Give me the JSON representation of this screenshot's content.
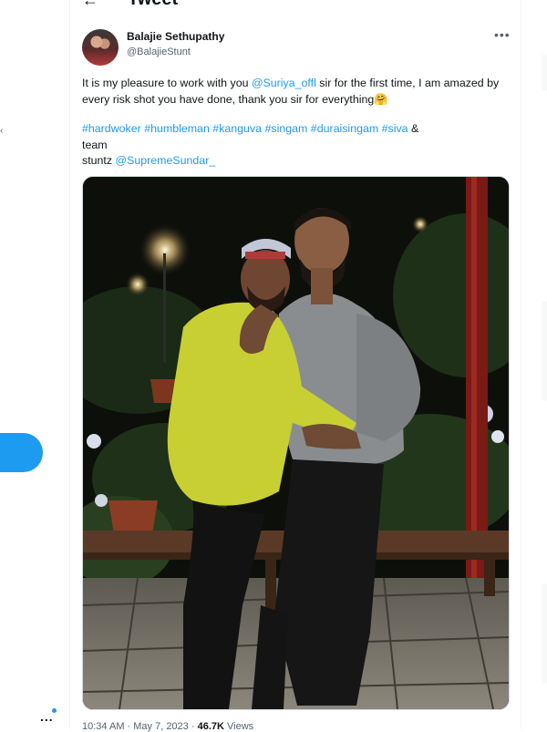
{
  "header": {
    "title": "Tweet",
    "back_icon": "arrow-left-icon"
  },
  "rail": {
    "post_button_color": "#1d9bf0",
    "more_label": "..."
  },
  "tweet": {
    "author_name": "Balajie Sethupathy",
    "author_handle": "@BalajieStunt",
    "menu_label": "•••",
    "text_before_mention": "It is my pleasure to work with you ",
    "mention_suriya": "@Suriya_offl",
    "text_after_mention": " sir for the first time, I am amazed by every risk shot you have done, thank you sir for everything",
    "emoji": "🤗",
    "hashtags": [
      "#hardwoker",
      "#humbleman",
      "#kanguva",
      "#singam",
      "#duraisingam",
      "#siva"
    ],
    "tags_suffix": "&",
    "team_label": "team",
    "stuntz_label": "stuntz ",
    "mention_supreme": "@SupremeSundar_",
    "time": "10:34 AM · May 7, 2023 · ",
    "views_count": "46.7K",
    "views_label": " Views"
  },
  "colors": {
    "accent": "#1d9bf0",
    "text": "#0f1419",
    "muted": "#536471"
  }
}
